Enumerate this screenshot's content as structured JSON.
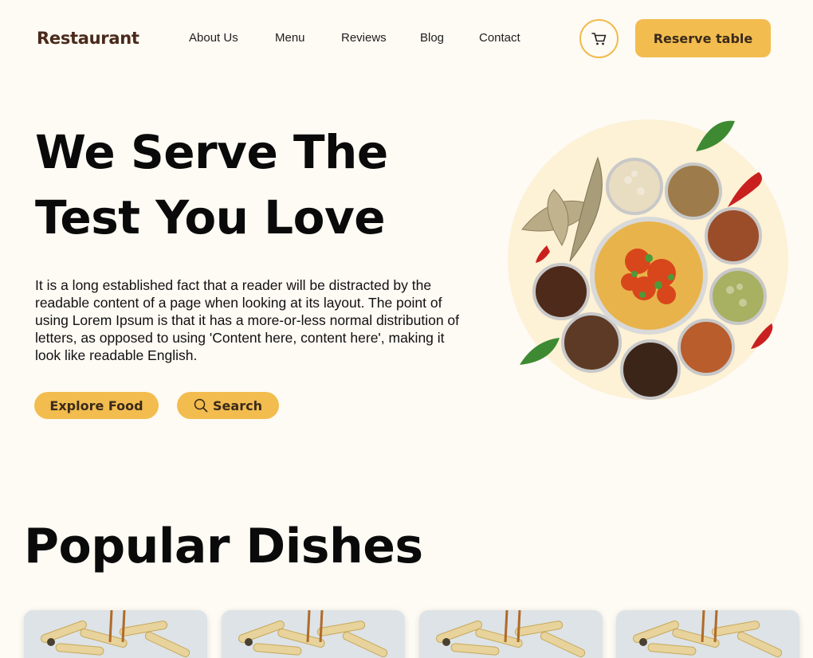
{
  "header": {
    "logo": "Restaurant",
    "nav": [
      "About Us",
      "Menu",
      "Reviews",
      "Blog",
      "Contact"
    ],
    "reserve_label": "Reserve table"
  },
  "hero": {
    "title_line1": "We Serve The",
    "title_line2": "Test You Love",
    "description": "It is a long established fact that a reader will be distracted by the readable content of a page when looking at its layout. The point of using Lorem Ipsum is that it has a more-or-less normal distribution of letters, as opposed to using 'Content here, content here', making it look like readable English.",
    "explore_label": "Explore Food",
    "search_label": "Search"
  },
  "popular": {
    "title": "Popular Dishes",
    "card_count_visible": 4
  },
  "colors": {
    "background": "#fefaf4",
    "accent": "#f2bc4e",
    "brand": "#4a2a1a"
  }
}
